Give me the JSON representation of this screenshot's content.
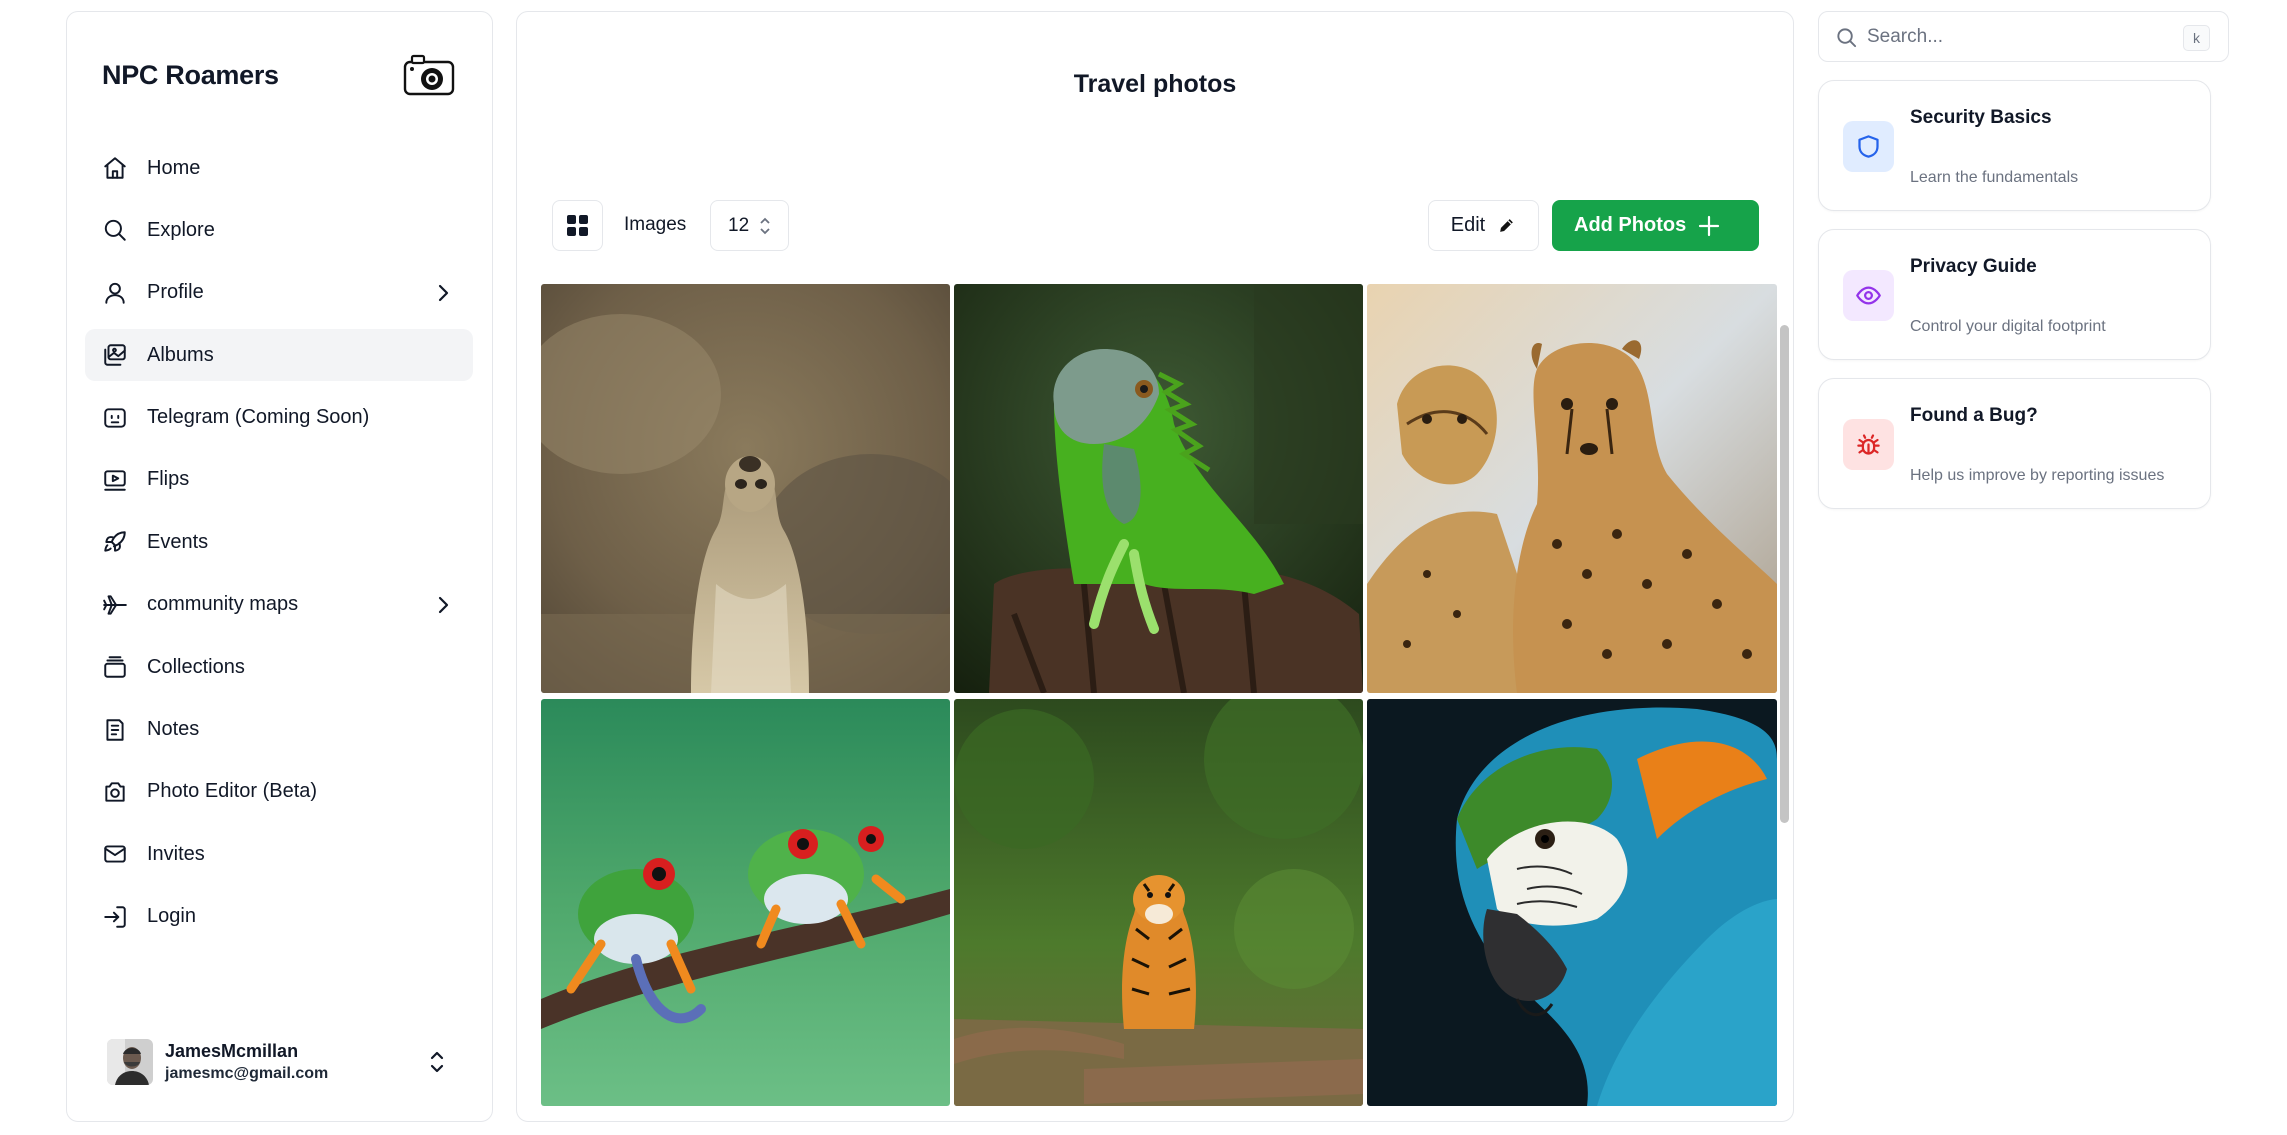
{
  "app": {
    "brand": "NPC Roamers"
  },
  "sidebar": {
    "items": [
      {
        "label": "Home",
        "icon": "home-icon",
        "has_chevron": false,
        "active": false
      },
      {
        "label": "Explore",
        "icon": "search-icon",
        "has_chevron": false,
        "active": false
      },
      {
        "label": "Profile",
        "icon": "user-icon",
        "has_chevron": true,
        "active": false
      },
      {
        "label": "Albums",
        "icon": "images-icon",
        "has_chevron": false,
        "active": true
      },
      {
        "label": "Telegram (Coming Soon)",
        "icon": "bot-icon",
        "has_chevron": false,
        "active": false
      },
      {
        "label": "Flips",
        "icon": "video-icon",
        "has_chevron": false,
        "active": false
      },
      {
        "label": "Events",
        "icon": "rocket-icon",
        "has_chevron": false,
        "active": false
      },
      {
        "label": "community maps",
        "icon": "plane-icon",
        "has_chevron": true,
        "active": false
      },
      {
        "label": "Collections",
        "icon": "layers-icon",
        "has_chevron": false,
        "active": false
      },
      {
        "label": "Notes",
        "icon": "notebook-icon",
        "has_chevron": false,
        "active": false
      },
      {
        "label": "Photo Editor (Beta)",
        "icon": "camera-icon",
        "has_chevron": false,
        "active": false
      },
      {
        "label": "Invites",
        "icon": "mail-icon",
        "has_chevron": false,
        "active": false
      },
      {
        "label": "Login",
        "icon": "login-icon",
        "has_chevron": false,
        "active": false
      }
    ],
    "user": {
      "name": "JamesMcmillan",
      "email": "jamesmc@gmail.com"
    }
  },
  "main": {
    "title": "Travel photos",
    "toolbar": {
      "images_label": "Images",
      "images_count": "12",
      "edit_label": "Edit",
      "add_label": "Add Photos"
    },
    "photos": [
      {
        "subject": "meerkat",
        "icon": "meerkat-photo"
      },
      {
        "subject": "iguana",
        "icon": "iguana-photo"
      },
      {
        "subject": "cheetahs",
        "icon": "cheetahs-photo"
      },
      {
        "subject": "tree frogs",
        "icon": "frogs-photo"
      },
      {
        "subject": "tiger",
        "icon": "tiger-photo"
      },
      {
        "subject": "macaw",
        "icon": "macaw-photo"
      }
    ]
  },
  "right": {
    "search": {
      "placeholder": "Search...",
      "shortcut": "k"
    },
    "cards": [
      {
        "title": "Security Basics",
        "desc": "Learn the fundamentals",
        "icon": "shield-icon",
        "bg": "#e0ecff",
        "color": "#2563eb"
      },
      {
        "title": "Privacy Guide",
        "desc": "Control your digital footprint",
        "icon": "eye-icon",
        "bg": "#f3e8ff",
        "color": "#9333ea"
      },
      {
        "title": "Found a Bug?",
        "desc": "Help us improve by reporting issues",
        "icon": "bug-icon",
        "bg": "#fee2e2",
        "color": "#dc2626"
      }
    ]
  },
  "colors": {
    "accent_green": "#16a34a",
    "active_nav": "#f3f4f6",
    "border": "#e5e7eb"
  }
}
